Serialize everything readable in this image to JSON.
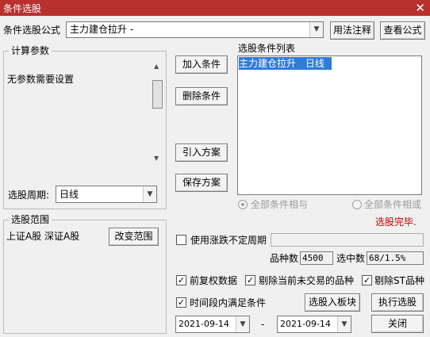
{
  "window": {
    "title": "条件选股",
    "close_glyph": "✕"
  },
  "formula": {
    "label": "条件选股公式",
    "value": "主力建仓拉升 -",
    "usage_btn": "用法注释",
    "view_btn": "查看公式"
  },
  "params": {
    "legend": "计算参数",
    "message": "无参数需要设置",
    "period_label": "选股周期:",
    "period_value": "日线"
  },
  "actions": {
    "add": "加入条件",
    "delete": "删除条件",
    "import": "引入方案",
    "save": "保存方案"
  },
  "condition_list": {
    "title": "选股条件列表",
    "items": [
      {
        "name": "主力建仓拉升",
        "period": "日线"
      }
    ]
  },
  "logic": {
    "all_and": "全部条件相与",
    "all_or": "全部条件相或"
  },
  "status": {
    "text": "选股完毕."
  },
  "range": {
    "legend": "选股范围",
    "value": "上证A股 深证A股",
    "change_btn": "改变范围"
  },
  "options": {
    "variable_period": {
      "label": "使用涨跌不定周期",
      "checked": false
    },
    "count_label": "品种数",
    "count_value": "4500",
    "selected_label": "选中数",
    "selected_value": "68/1.5%",
    "adjusted": {
      "label": "前复权数据",
      "checked": true
    },
    "exclude_untraded": {
      "label": "剔除当前未交易的品种",
      "checked": true
    },
    "exclude_st": {
      "label": "剔除ST品种",
      "checked": true
    },
    "time_range": {
      "label": "时间段内满足条件",
      "checked": true
    }
  },
  "dates": {
    "start": "2021-09-14",
    "end": "2021-09-14",
    "separator": "-"
  },
  "buttons": {
    "to_block": "选股入板块",
    "run": "执行选股",
    "close": "关闭"
  }
}
